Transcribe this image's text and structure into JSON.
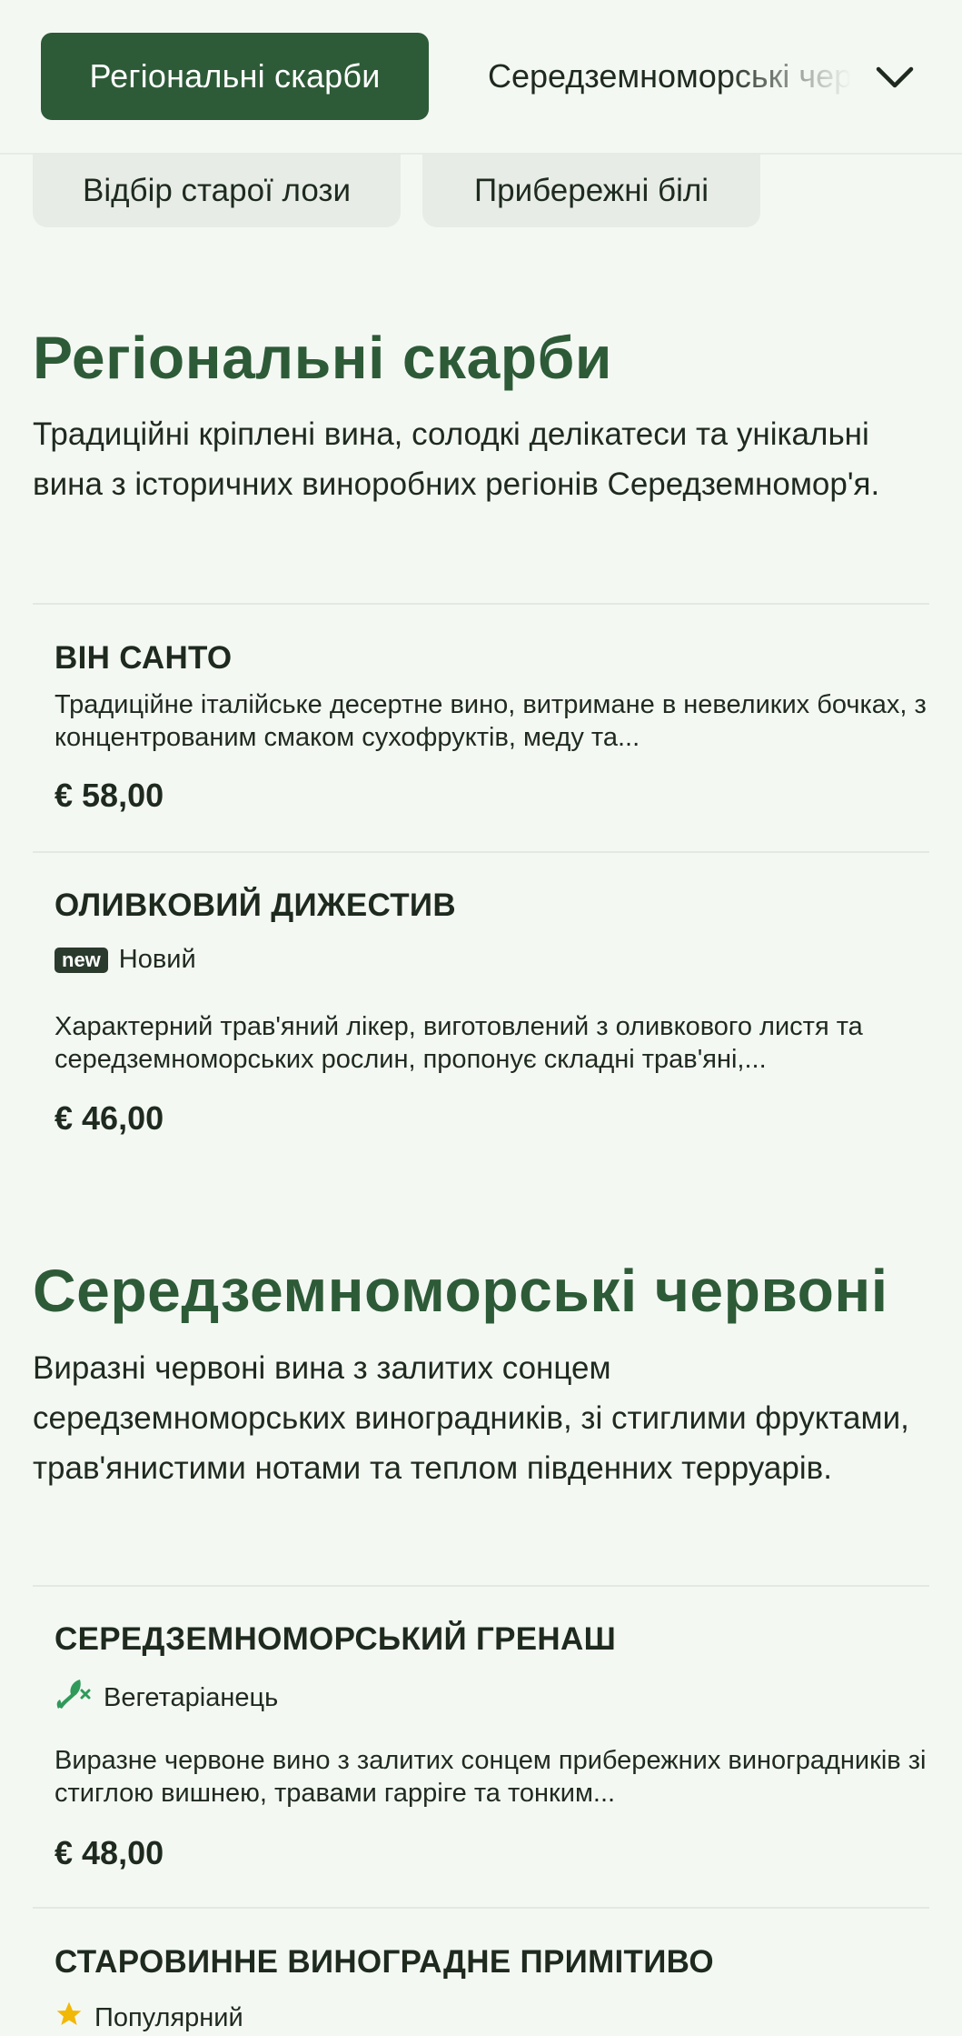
{
  "nav": {
    "active_tab": "Регіональні скарби",
    "next_tab": "Середземноморські червоні",
    "pills": [
      "Відбір старої лози",
      "Прибережні білі"
    ]
  },
  "sections": [
    {
      "title": "Регіональні скарби",
      "description": "Традиційні кріплені вина, солодкі делікатеси та унікальні вина з історичних виноробних регіонів Середземномор'я.",
      "items": [
        {
          "name": "ВІН САНТО",
          "description": "Традиційне італійське десертне вино, витримане в невеликих бочках, з концентрованим смаком сухофруктів, меду та...",
          "price": "€ 58,00"
        },
        {
          "name": "ОЛИВКОВИЙ ДИЖЕСТИВ",
          "badge": "new",
          "tag": "Новий",
          "description": "Характерний трав'яний лікер, виготовлений з оливкового листя та середземноморських рослин, пропонує складні трав'яні,...",
          "price": "€ 46,00"
        }
      ]
    },
    {
      "title": "Середземноморські червоні",
      "description": "Виразні червоні вина з залитих сонцем середземноморських виноградників, зі стиглими фруктами, трав'янистими нотами та теплом південних терруарів.",
      "items": [
        {
          "name": "СЕРЕДЗЕМНОМОРСЬКИЙ ГРЕНАШ",
          "tag": "Вегетаріанець",
          "tag_icon": "vegetarian-icon",
          "description": "Виразне червоне вино з залитих сонцем прибережних виноградників зі стиглою вишнею, травами гарріге та тонким...",
          "price": "€ 48,00"
        },
        {
          "name": "СТАРОВИННЕ ВИНОГРАДНЕ ПРИМІТИВО",
          "tag": "Популярний",
          "tag_icon": "star-icon"
        }
      ]
    }
  ],
  "colors": {
    "accent": "#2d5b37",
    "background": "#f4f8f3",
    "pill_bg": "#e7ede6",
    "vegetarian_icon": "#2f9a5a",
    "star_icon": "#f2b807"
  }
}
